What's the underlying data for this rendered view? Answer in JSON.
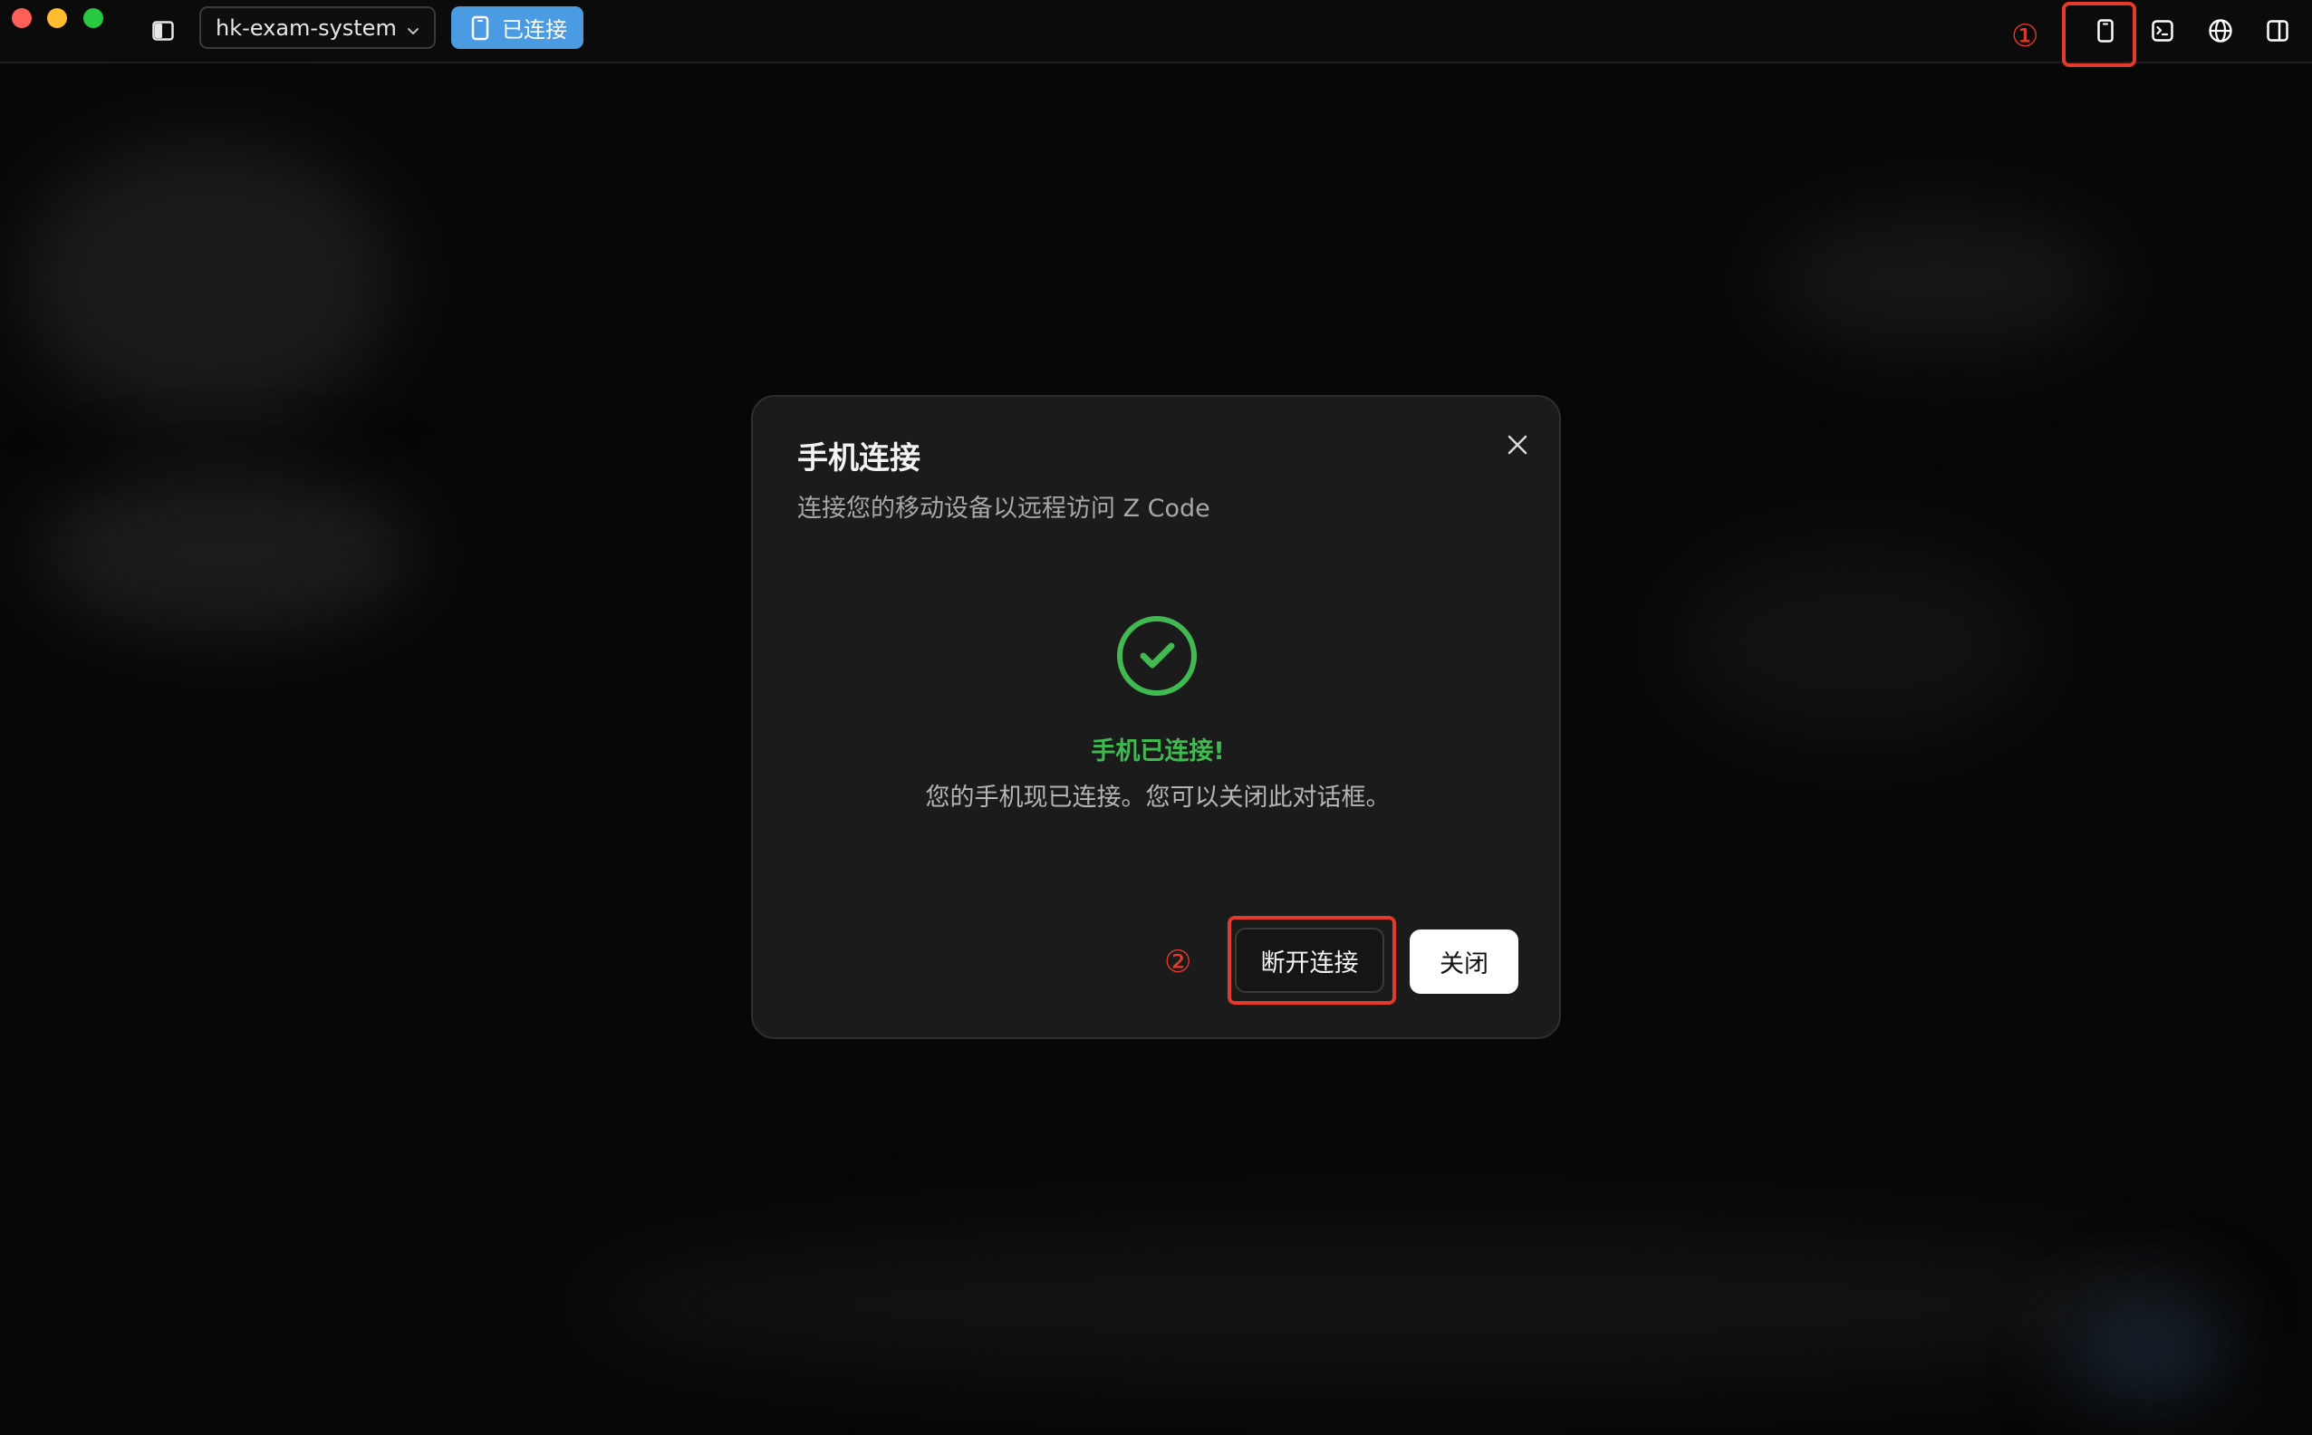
{
  "window": {
    "project_name": "hk-exam-system",
    "connection_badge": "已连接"
  },
  "toolbar": {
    "icons": [
      "mobile-device-icon",
      "terminal-icon",
      "globe-icon",
      "panel-right-icon"
    ]
  },
  "annotations": {
    "marker_1": "①",
    "marker_2": "②"
  },
  "modal": {
    "title": "手机连接",
    "subtitle": "连接您的移动设备以远程访问 Z Code",
    "status_title": "手机已连接!",
    "status_description": "您的手机现已连接。您可以关闭此对话框。",
    "disconnect_label": "断开连接",
    "close_label": "关闭"
  },
  "colors": {
    "accent_badge": "#4a9be2",
    "success": "#3fb950",
    "annotation": "#e53a2b"
  }
}
